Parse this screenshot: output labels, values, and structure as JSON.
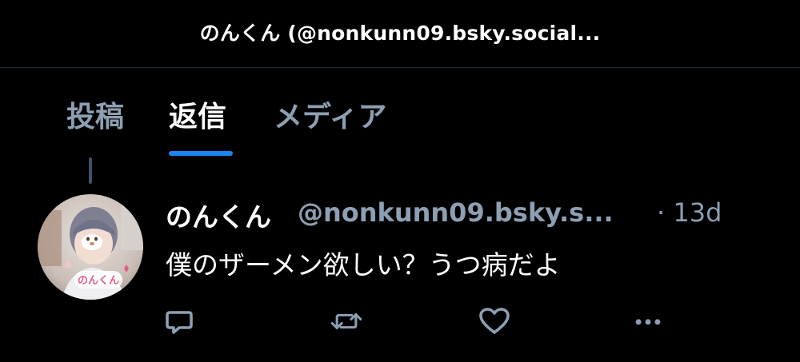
{
  "header": {
    "title": "のんくん (@nonkunn09.bsky.social..."
  },
  "tabs": [
    {
      "label": "投稿",
      "active": false
    },
    {
      "label": "返信",
      "active": true
    },
    {
      "label": "メディア",
      "active": false
    }
  ],
  "post": {
    "author_name": "のんくん",
    "author_handle": "@nonkunn09.bsky.s...",
    "timestamp": "· 13d",
    "text": "僕のザーメン欲しい？うつ病だよ",
    "avatar_sticker_text": "のんくん"
  },
  "actions": [
    {
      "name": "reply",
      "icon": "speech-bubble-icon"
    },
    {
      "name": "repost",
      "icon": "repost-arrows-icon"
    },
    {
      "name": "like",
      "icon": "heart-icon"
    },
    {
      "name": "more",
      "icon": "ellipsis-icon"
    }
  ],
  "colors": {
    "background": "#000000",
    "primary_text": "#ffffff",
    "secondary_text": "#8d9fb2",
    "accent": "#1d83f0",
    "divider": "#1f2a36"
  }
}
